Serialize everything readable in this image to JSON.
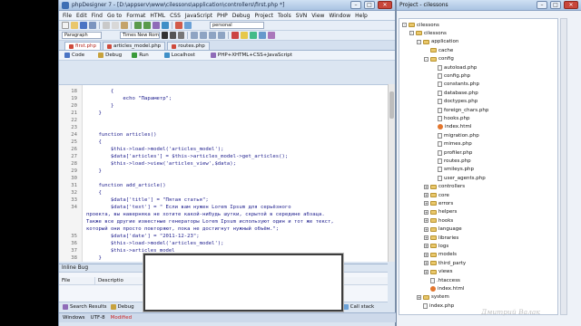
{
  "window": {
    "title": "phpDesigner 7 - [D:\\appserv\\www\\cilessons\\application\\controllers\\first.php *]",
    "minimize": "–",
    "maximize": "□",
    "close": "✕"
  },
  "menu": [
    "File",
    "Edit",
    "Find",
    "Go to",
    "Format",
    "HTML",
    "CSS",
    "JavaScript",
    "PHP",
    "Debug",
    "Project",
    "Tools",
    "SVN",
    "View",
    "Window",
    "Help"
  ],
  "toolbar": {
    "profile": "personal",
    "paragraph": "Paragraph",
    "font": "Times New Rom"
  },
  "tabs": [
    {
      "label": "first.php",
      "active": true
    },
    {
      "label": "articles_model.php",
      "active": false
    },
    {
      "label": "routes.php",
      "active": false
    }
  ],
  "subbar": {
    "code": "Code",
    "debug": "Debug",
    "run": "Run",
    "localhost": "Localhost",
    "mode": "PHP+XHTML+CSS+JavaScript"
  },
  "editor": {
    "lines": [
      {
        "n": "18",
        "code": "        {"
      },
      {
        "n": "19",
        "code": "            echo \"Параметр\";"
      },
      {
        "n": "20",
        "code": "        }"
      },
      {
        "n": "21",
        "code": "    }"
      },
      {
        "n": "22",
        "code": ""
      },
      {
        "n": "23",
        "code": ""
      },
      {
        "n": "24",
        "code": "    function articles()"
      },
      {
        "n": "25",
        "code": "    {"
      },
      {
        "n": "26",
        "code": "        $this->load->model('articles_model');"
      },
      {
        "n": "27",
        "code": "        $data['articles'] = $this->articles_model->get_articles();"
      },
      {
        "n": "28",
        "code": "        $this->load->view('articles_view',$data);"
      },
      {
        "n": "29",
        "code": "    }"
      },
      {
        "n": "30",
        "code": ""
      },
      {
        "n": "31",
        "code": "    function add_article()"
      },
      {
        "n": "32",
        "code": "    {"
      },
      {
        "n": "33",
        "code": "        $data['title'] = \"Пятая статья\";"
      },
      {
        "n": "34",
        "code": "        $data['text'] = \" Если вам нужен Lorem Ipsum для серьёзного"
      },
      {
        "n": "",
        "code": "проекта, вы наверняка не хотите какой-нибудь шутки, скрытой в середине абзаца."
      },
      {
        "n": "",
        "code": "Также все другие известные генераторы Lorem Ipsum используют один и тот же текст,"
      },
      {
        "n": "",
        "code": "который они просто повторяют, пока не достигнут нужный объём.\";"
      },
      {
        "n": "35",
        "code": "        $data['date'] = \"2011-12-23\";"
      },
      {
        "n": "36",
        "code": "        $this->load->model('articles_model');"
      },
      {
        "n": "37",
        "code": "        $this->articles_model"
      },
      {
        "n": "38",
        "code": "    }"
      }
    ]
  },
  "inline_bug": {
    "title": "Inline Bug",
    "col_file": "File",
    "col_description": "Descriptio"
  },
  "bottom_tabs": [
    "Search Results",
    "Debug",
    "Call stack"
  ],
  "status": {
    "os": "Windows",
    "encoding": "UTF-8",
    "state": "Modified"
  },
  "project": {
    "title": "Project - cilessons",
    "tree": [
      {
        "label": "cilessons",
        "depth": 0,
        "kind": "folder",
        "exp": "-"
      },
      {
        "label": "cilessons",
        "depth": 1,
        "kind": "folder",
        "exp": "-"
      },
      {
        "label": "application",
        "depth": 2,
        "kind": "folder",
        "exp": "-"
      },
      {
        "label": "cache",
        "depth": 3,
        "kind": "folder",
        "exp": ""
      },
      {
        "label": "config",
        "depth": 3,
        "kind": "folder",
        "exp": "-"
      },
      {
        "label": "autoload.php",
        "depth": 4,
        "kind": "file",
        "exp": ""
      },
      {
        "label": "config.php",
        "depth": 4,
        "kind": "file",
        "exp": ""
      },
      {
        "label": "constants.php",
        "depth": 4,
        "kind": "file",
        "exp": ""
      },
      {
        "label": "database.php",
        "depth": 4,
        "kind": "file",
        "exp": ""
      },
      {
        "label": "doctypes.php",
        "depth": 4,
        "kind": "file",
        "exp": ""
      },
      {
        "label": "foreign_chars.php",
        "depth": 4,
        "kind": "file",
        "exp": ""
      },
      {
        "label": "hooks.php",
        "depth": 4,
        "kind": "file",
        "exp": ""
      },
      {
        "label": "index.html",
        "depth": 4,
        "kind": "html",
        "exp": ""
      },
      {
        "label": "migration.php",
        "depth": 4,
        "kind": "file",
        "exp": ""
      },
      {
        "label": "mimes.php",
        "depth": 4,
        "kind": "file",
        "exp": ""
      },
      {
        "label": "profiler.php",
        "depth": 4,
        "kind": "file",
        "exp": ""
      },
      {
        "label": "routes.php",
        "depth": 4,
        "kind": "file",
        "exp": ""
      },
      {
        "label": "smileys.php",
        "depth": 4,
        "kind": "file",
        "exp": ""
      },
      {
        "label": "user_agents.php",
        "depth": 4,
        "kind": "file",
        "exp": ""
      },
      {
        "label": "controllers",
        "depth": 3,
        "kind": "folder",
        "exp": "+"
      },
      {
        "label": "core",
        "depth": 3,
        "kind": "folder",
        "exp": "+"
      },
      {
        "label": "errors",
        "depth": 3,
        "kind": "folder",
        "exp": "+"
      },
      {
        "label": "helpers",
        "depth": 3,
        "kind": "folder",
        "exp": "+"
      },
      {
        "label": "hooks",
        "depth": 3,
        "kind": "folder",
        "exp": "+"
      },
      {
        "label": "language",
        "depth": 3,
        "kind": "folder",
        "exp": "+"
      },
      {
        "label": "libraries",
        "depth": 3,
        "kind": "folder",
        "exp": "+"
      },
      {
        "label": "logs",
        "depth": 3,
        "kind": "folder",
        "exp": "+"
      },
      {
        "label": "models",
        "depth": 3,
        "kind": "folder",
        "exp": "+"
      },
      {
        "label": "third_party",
        "depth": 3,
        "kind": "folder",
        "exp": "+"
      },
      {
        "label": "views",
        "depth": 3,
        "kind": "folder",
        "exp": "+"
      },
      {
        "label": ".htaccess",
        "depth": 3,
        "kind": "file",
        "exp": ""
      },
      {
        "label": "index.html",
        "depth": 3,
        "kind": "html",
        "exp": ""
      },
      {
        "label": "system",
        "depth": 2,
        "kind": "folder",
        "exp": "+"
      },
      {
        "label": "index.php",
        "depth": 2,
        "kind": "file",
        "exp": ""
      }
    ]
  },
  "watermark": "Дмитрий Валак",
  "colors": {
    "accent": "#3d6fb4",
    "active_tab_text": "#b2231b",
    "code_text": "#1c1c8c",
    "modified": "#cc2222"
  }
}
